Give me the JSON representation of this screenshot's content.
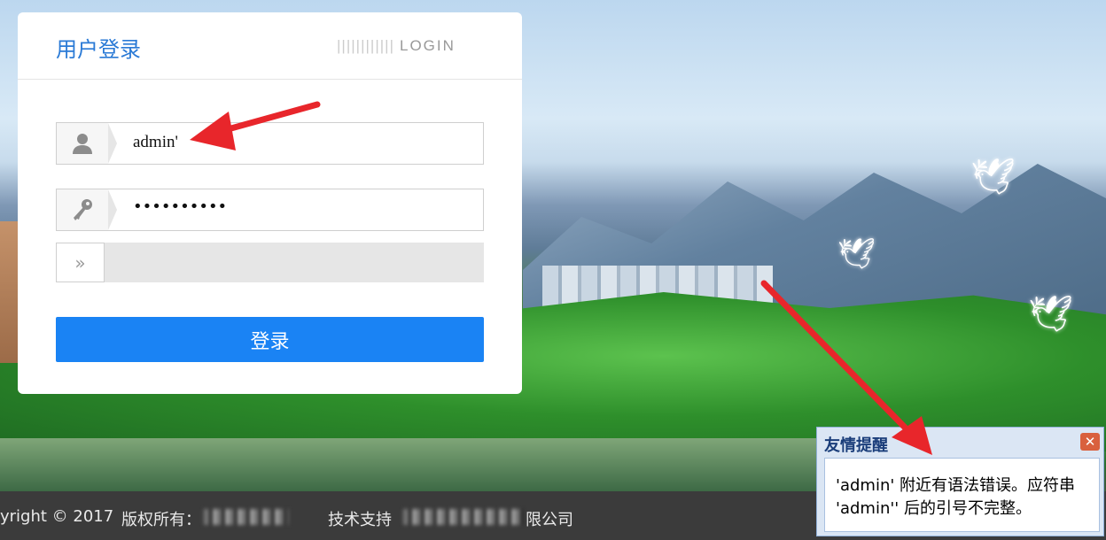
{
  "login": {
    "title": "用户登录",
    "brand_bars": "||||||||||||",
    "brand_text": "LOGIN",
    "username_value": "admin'",
    "password_value": "••••••••••",
    "captcha_icon": "»",
    "submit_label": "登录"
  },
  "footer": {
    "copyright": "yright © 2017",
    "owner_label": "版权所有：",
    "support_label": "技术支持",
    "support_suffix": "限公司"
  },
  "popup": {
    "title": "友情提醒",
    "close": "✕",
    "message": "'admin' 附近有语法错误。应符串 'admin'' 后的引号不完整。"
  },
  "icons": {
    "user": "user-icon",
    "key": "key-icon"
  },
  "colors": {
    "accent": "#1a83f4",
    "title_blue": "#2a7ad6",
    "annotation_red": "#e8262b"
  }
}
